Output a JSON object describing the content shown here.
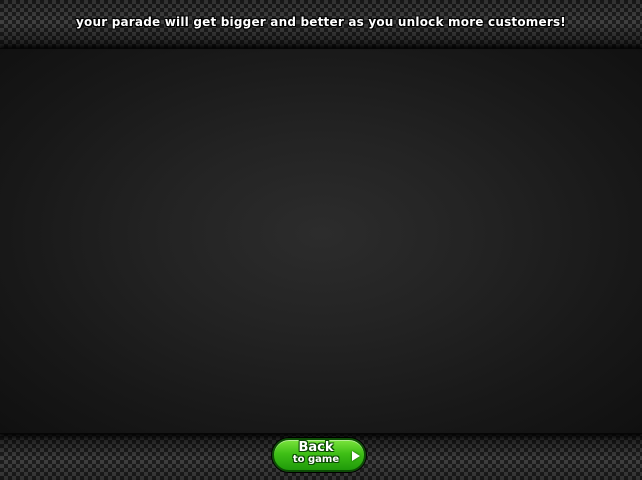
{
  "header": {
    "message": "your parade will get bigger and better as you unlock more customers!"
  },
  "footer": {
    "back_button": {
      "line1": "Back",
      "line2": "to Game",
      "icon": "play-arrow-icon"
    }
  },
  "colors": {
    "button_green": "#3fbf16",
    "button_border": "#0d4d05",
    "stage_center": "#2c2c2c",
    "checker_light": "#4a4a4a",
    "checker_dark": "#222222"
  }
}
